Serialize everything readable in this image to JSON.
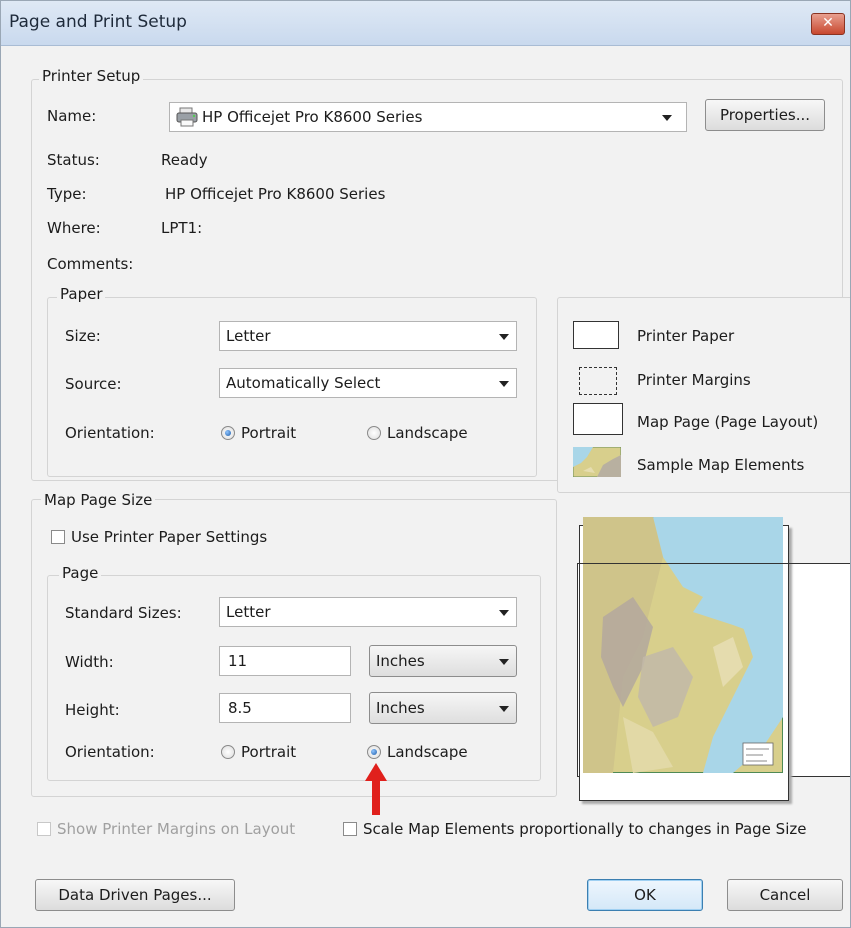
{
  "window": {
    "title": "Page and Print Setup",
    "close_glyph": "✕"
  },
  "printer_setup": {
    "legend": "Printer Setup",
    "name_label": "Name:",
    "name_value": "HP Officejet Pro K8600 Series",
    "properties_button": "Properties...",
    "status_label": "Status:",
    "status_value": "Ready",
    "type_label": "Type:",
    "type_value": "HP Officejet Pro K8600 Series",
    "where_label": "Where:",
    "where_value": "LPT1:",
    "comments_label": "Comments:",
    "paper": {
      "legend": "Paper",
      "size_label": "Size:",
      "size_value": "Letter",
      "source_label": "Source:",
      "source_value": "Automatically Select",
      "orientation_label": "Orientation:",
      "portrait_label": "Portrait",
      "landscape_label": "Landscape",
      "selected": "Portrait"
    }
  },
  "legend_items": {
    "printer_paper": "Printer Paper",
    "printer_margins": "Printer Margins",
    "map_page": "Map Page (Page Layout)",
    "sample_map": "Sample Map Elements"
  },
  "map_page_size": {
    "legend": "Map Page Size",
    "use_printer_paper_label": "Use Printer Paper Settings",
    "use_printer_paper_checked": false,
    "page": {
      "legend": "Page",
      "standard_sizes_label": "Standard Sizes:",
      "standard_sizes_value": "Letter",
      "width_label": "Width:",
      "width_value": "11",
      "width_unit": "Inches",
      "height_label": "Height:",
      "height_value": "8.5",
      "height_unit": "Inches",
      "orientation_label": "Orientation:",
      "portrait_label": "Portrait",
      "landscape_label": "Landscape",
      "selected": "Landscape"
    }
  },
  "bottom": {
    "show_margins_label": "Show Printer Margins on Layout",
    "scale_elements_label": "Scale Map Elements proportionally to changes in Page Size",
    "data_driven_pages_button": "Data Driven Pages...",
    "ok_button": "OK",
    "cancel_button": "Cancel"
  },
  "colors": {
    "annotation_arrow": "#e0201c",
    "focus_border": "#3c7fb1",
    "map_water": "#a9d6e8",
    "map_land": "#d8cf8c"
  }
}
